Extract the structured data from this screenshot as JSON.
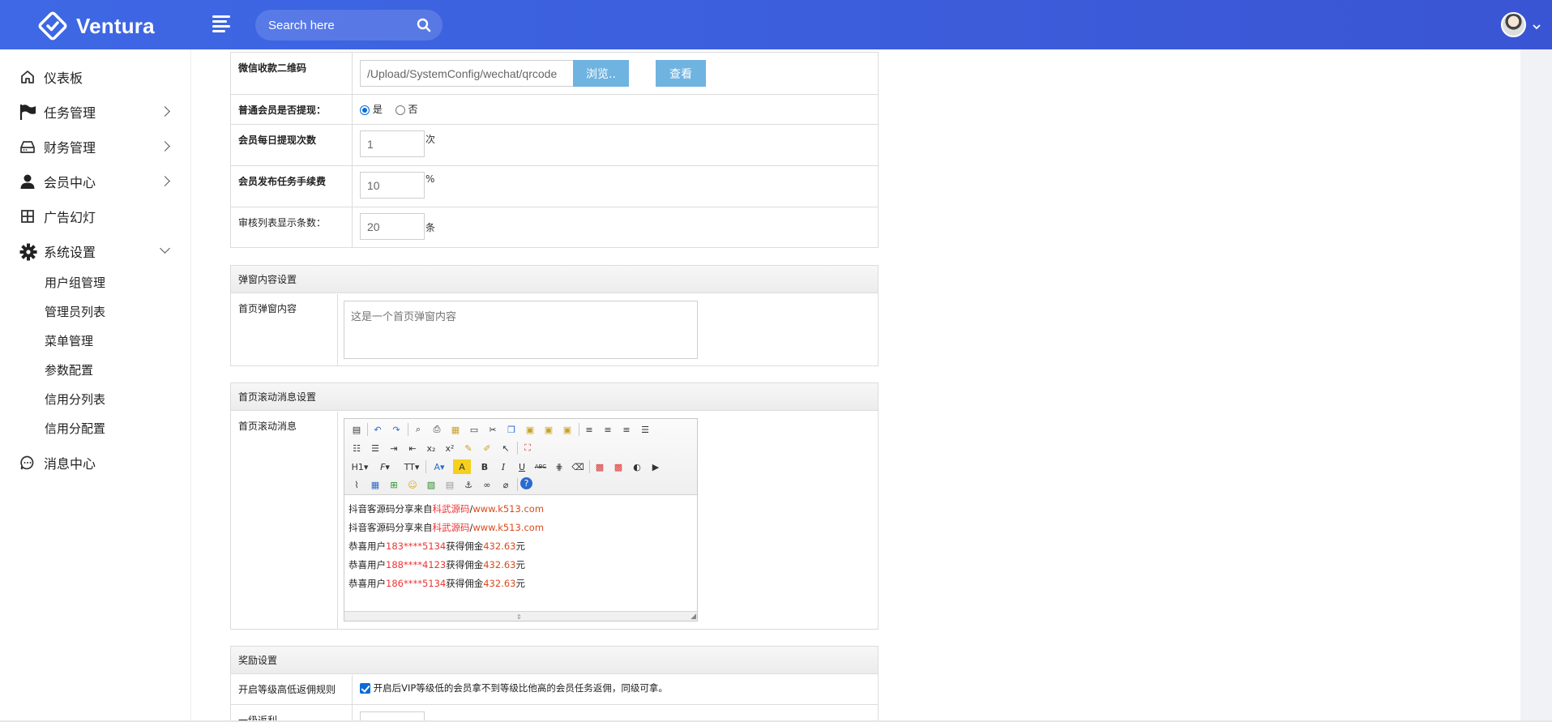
{
  "brand": {
    "name": "Ventura"
  },
  "search": {
    "placeholder": "Search here"
  },
  "sidebar": {
    "items": [
      {
        "label": "仪表板",
        "icon": "home-icon"
      },
      {
        "label": "任务管理",
        "icon": "flag-icon"
      },
      {
        "label": "财务管理",
        "icon": "hard-drive-icon"
      },
      {
        "label": "会员中心",
        "icon": "user-icon"
      },
      {
        "label": "广告幻灯",
        "icon": "grid-icon"
      },
      {
        "label": "系统设置",
        "icon": "gear-icon"
      },
      {
        "label": "消息中心",
        "icon": "chat-icon"
      }
    ],
    "sub_items": [
      "用户组管理",
      "管理员列表",
      "菜单管理",
      "参数配置",
      "信用分列表",
      "信用分配置"
    ]
  },
  "form": {
    "wechat_qr": {
      "label": "微信收款二维码",
      "value": "/Upload/SystemConfig/wechat/qrcode",
      "browse": "浏览..",
      "view": "查看"
    },
    "withdraw": {
      "label": "普通会员是否提现：",
      "yes": "是",
      "no": "否"
    },
    "daily_withdraw": {
      "label": "会员每日提现次数",
      "value": "1",
      "unit": "次"
    },
    "task_fee": {
      "label": "会员发布任务手续费",
      "value": "10",
      "unit": "%"
    },
    "review_count": {
      "label": "审核列表显示条数：",
      "value": "20",
      "unit": "条"
    }
  },
  "popup": {
    "header": "弹窗内容设置",
    "label": "首页弹窗内容",
    "placeholder": "这是一个首页弹窗内容"
  },
  "scroll": {
    "header": "首页滚动消息设置",
    "label": "首页滚动消息",
    "toolbar": {
      "h1": "H1",
      "font": "F",
      "size": "TT",
      "bold": "B",
      "italic": "I",
      "underline": "U",
      "strike": "ABC"
    },
    "lines": [
      {
        "a": "抖音客源码分享来自",
        "b": "科武源码",
        "c": "/",
        "d": "www.k513.com"
      },
      {
        "a": "抖音客源码分享来自",
        "b": "科武源码",
        "c": "/",
        "d": "www.k513.com"
      },
      {
        "a": "恭喜用户",
        "b": "183****5134",
        "c": "获得佣金",
        "d": "432.63",
        "e": "元"
      },
      {
        "a": "恭喜用户",
        "b": "188****4123",
        "c": "获得佣金",
        "d": "432.63",
        "e": "元"
      },
      {
        "a": "恭喜用户",
        "b": "186****5134",
        "c": "获得佣金",
        "d": "432.63",
        "e": "元"
      }
    ]
  },
  "reward": {
    "header": "奖励设置",
    "rule_label": "开启等级高低返佣规则",
    "rule_text": "开启后VIP等级低的会员拿不到等级比他高的会员任务返佣，同级可拿。",
    "level1_label": "一级返利"
  },
  "colors": {
    "topbar": "#3e68e5",
    "button": "#6fb3e0",
    "red_text": "#e33333"
  }
}
